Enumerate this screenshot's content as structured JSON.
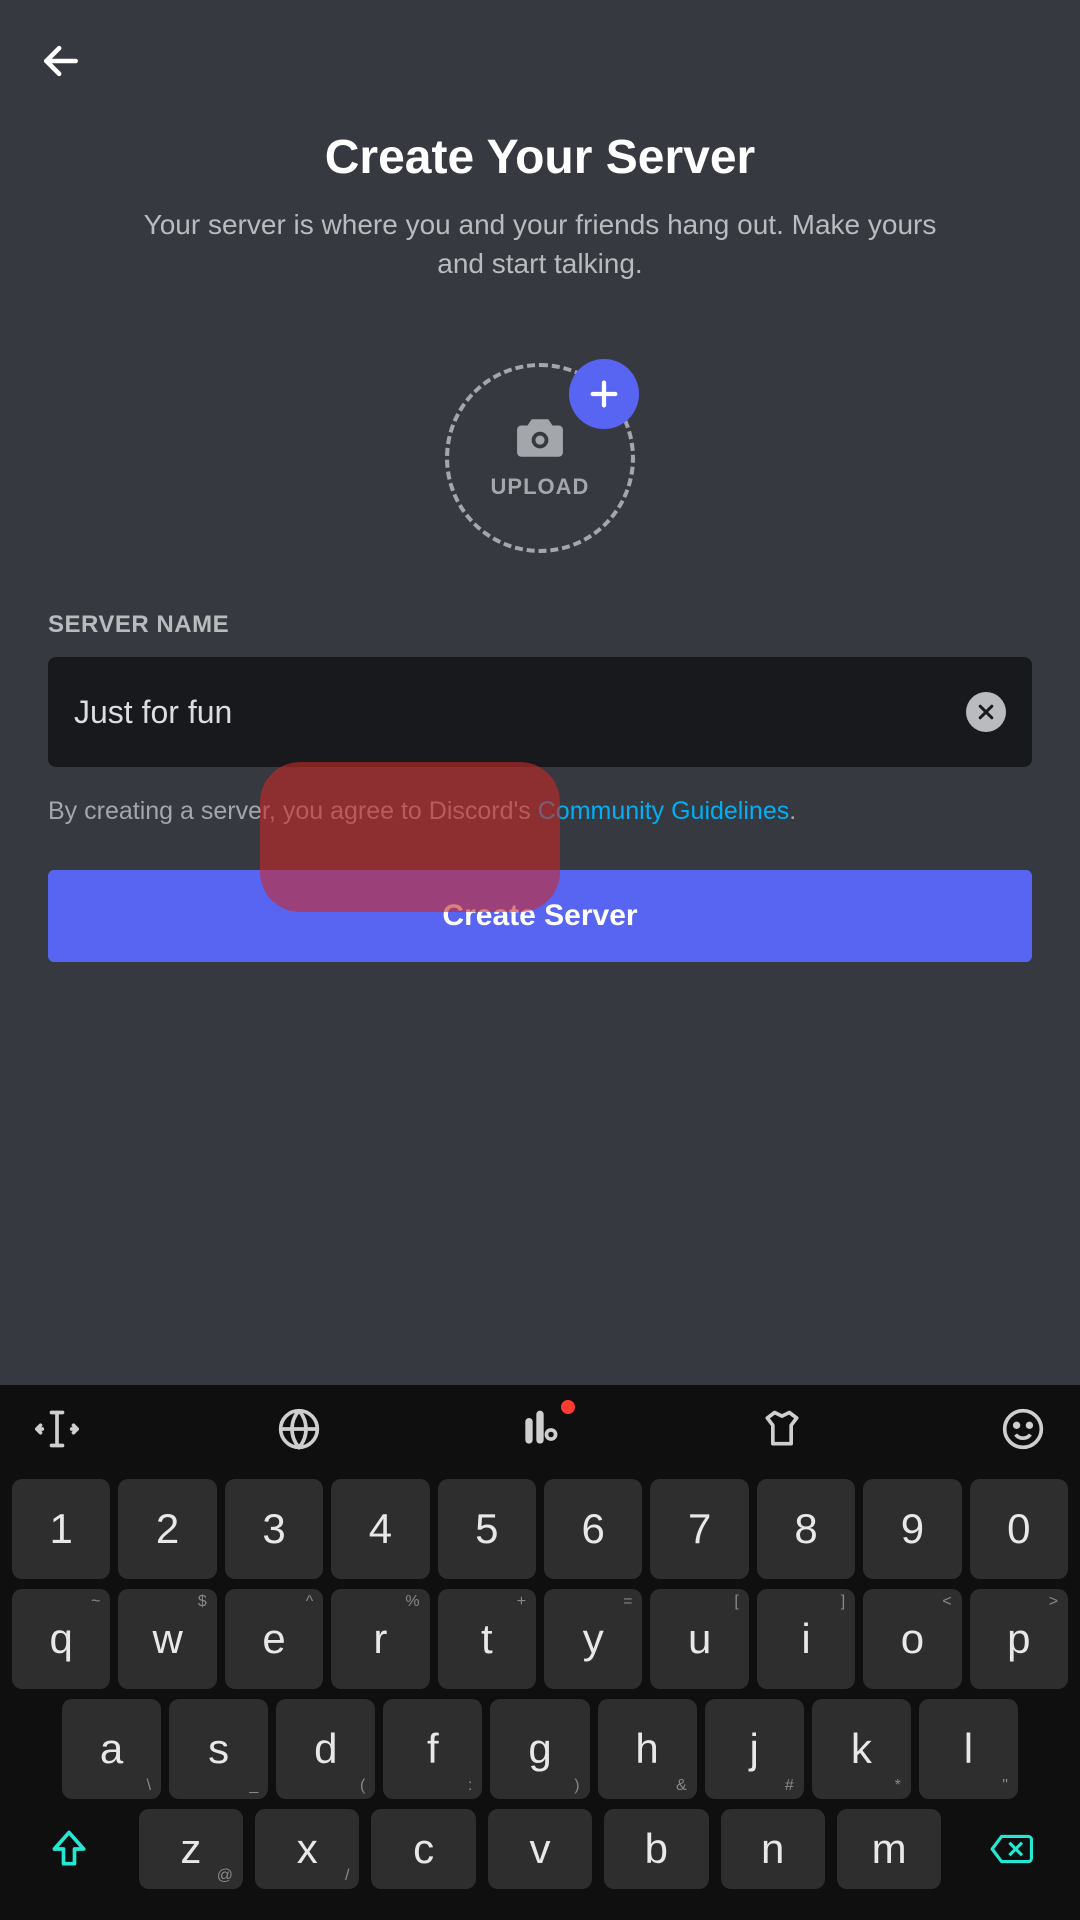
{
  "header": {
    "title": "Create Your Server",
    "subtitle": "Your server is where you and your friends hang out. Make yours and start talking."
  },
  "upload": {
    "label": "UPLOAD"
  },
  "form": {
    "field_label": "SERVER NAME",
    "server_name_value": "Just for fun",
    "agreement_prefix": "By creating a server, you agree to Discord's ",
    "agreement_link": "Community Guidelines",
    "agreement_suffix": ".",
    "create_label": "Create Server"
  },
  "keyboard": {
    "row_num": [
      "1",
      "2",
      "3",
      "4",
      "5",
      "6",
      "7",
      "8",
      "9",
      "0"
    ],
    "row1": [
      {
        "main": "q",
        "sup": "~"
      },
      {
        "main": "w",
        "sup": "$"
      },
      {
        "main": "e",
        "sup": "^"
      },
      {
        "main": "r",
        "sup": "%"
      },
      {
        "main": "t",
        "sup": "+"
      },
      {
        "main": "y",
        "sup": "="
      },
      {
        "main": "u",
        "sup": "["
      },
      {
        "main": "i",
        "sup": "]"
      },
      {
        "main": "o",
        "sup": "<"
      },
      {
        "main": "p",
        "sup": ">"
      }
    ],
    "row2": [
      {
        "main": "a",
        "sub": "\\"
      },
      {
        "main": "s",
        "sub": "_"
      },
      {
        "main": "d",
        "sub": "("
      },
      {
        "main": "f",
        "sub": ":"
      },
      {
        "main": "g",
        "sub": ")"
      },
      {
        "main": "h",
        "sub": "&"
      },
      {
        "main": "j",
        "sub": "#"
      },
      {
        "main": "k",
        "sub": "*"
      },
      {
        "main": "l",
        "sub": "\""
      }
    ],
    "row3": [
      {
        "main": "z",
        "sub": "@"
      },
      {
        "main": "x",
        "sub": "/"
      },
      {
        "main": "c",
        "sub": ""
      },
      {
        "main": "v",
        "sub": ""
      },
      {
        "main": "b",
        "sub": ""
      },
      {
        "main": "n",
        "sub": ""
      },
      {
        "main": "m",
        "sub": ""
      }
    ]
  }
}
